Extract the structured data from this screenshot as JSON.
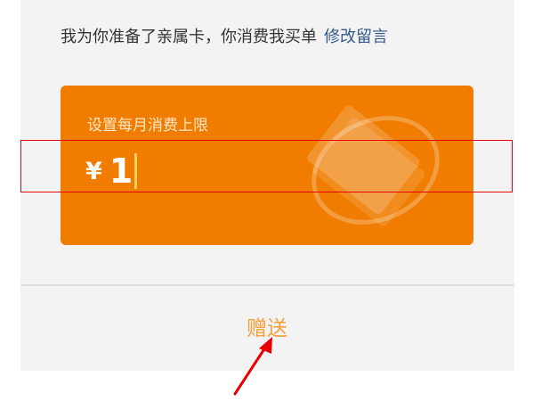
{
  "message": {
    "text": "我为你准备了亲属卡，你消费我买单",
    "edit_link": "修改留言"
  },
  "card": {
    "limit_label": "设置每月消费上限",
    "currency": "¥",
    "amount": "1"
  },
  "actions": {
    "gift_label": "赠送"
  },
  "colors": {
    "card": "#f07c00",
    "link": "#35598c",
    "gift": "#f5a03a",
    "annotation": "#e80000"
  },
  "icons": {
    "card_decoration": "card-orbit-icon",
    "arrow": "red-arrow-icon"
  }
}
